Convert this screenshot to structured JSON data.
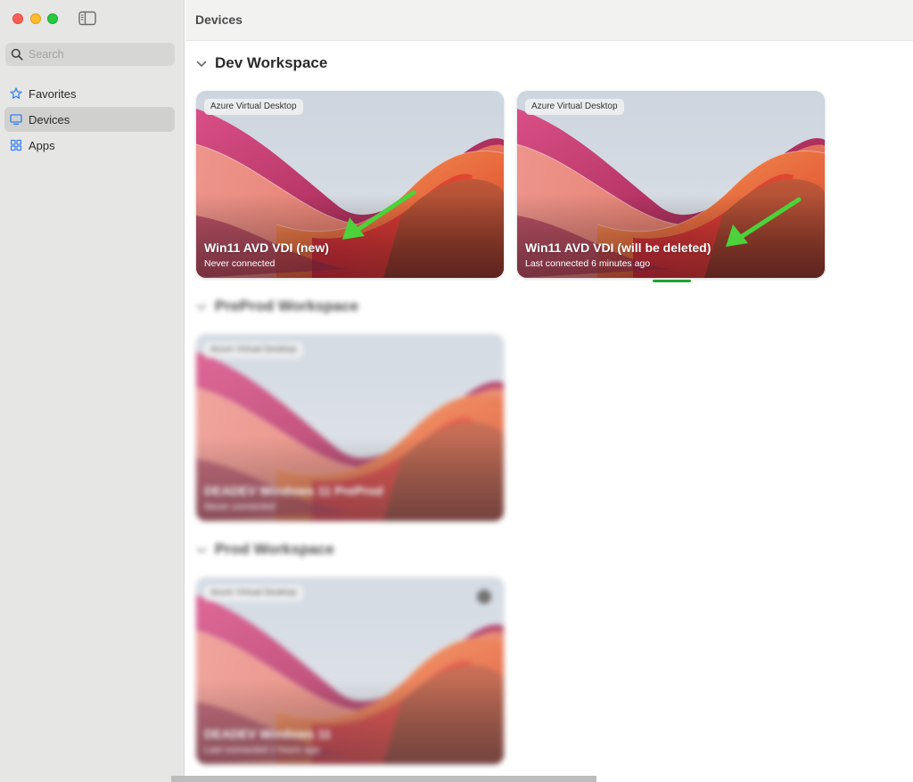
{
  "window": {
    "title": "Devices"
  },
  "sidebar": {
    "search_placeholder": "Search",
    "items": [
      {
        "label": "Favorites",
        "icon": "star-icon"
      },
      {
        "label": "Devices",
        "icon": "monitor-icon",
        "selected": true
      },
      {
        "label": "Apps",
        "icon": "apps-grid-icon"
      }
    ]
  },
  "workspaces": [
    {
      "name": "Dev Workspace",
      "devices": [
        {
          "badge": "Azure Virtual Desktop",
          "name": "Win11 AVD VDI (new)",
          "status": "Never connected"
        },
        {
          "badge": "Azure Virtual Desktop",
          "name": "Win11 AVD VDI (will be deleted)",
          "status": "Last connected 6 minutes ago"
        }
      ]
    },
    {
      "name": "PreProd Workspace",
      "blurred": true,
      "devices": [
        {
          "badge": "Azure Virtual Desktop",
          "name": "DEADEV Windows 11 PreProd",
          "status": "Never connected"
        }
      ]
    },
    {
      "name": "Prod Workspace",
      "blurred": true,
      "devices": [
        {
          "badge": "Azure Virtual Desktop",
          "name": "DEADEV Windows 11",
          "status": "Last connected 1 hours ago"
        }
      ]
    }
  ],
  "colors": {
    "sidebar_bg": "#e6e6e5",
    "accent_blue": "#2f7cf6",
    "annotation_arrow": "#4cd23a",
    "selected_underline": "#1fa32e"
  }
}
